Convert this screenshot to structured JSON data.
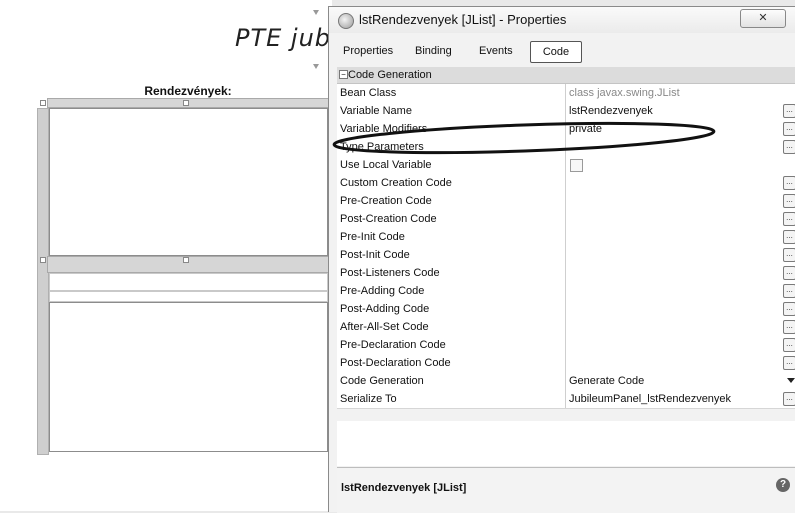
{
  "designer": {
    "title": "PTE jub",
    "panel_header": "Rendezvények:"
  },
  "window": {
    "title": "lstRendezvenyek [JList] - Properties",
    "close_label": "✕"
  },
  "tabs": [
    {
      "label": "Properties",
      "active": false
    },
    {
      "label": "Binding",
      "active": false
    },
    {
      "label": "Events",
      "active": false
    },
    {
      "label": "Code",
      "active": true
    }
  ],
  "category": {
    "label": "Code Generation",
    "expanded_symbol": "−"
  },
  "properties": [
    {
      "name": "Bean Class",
      "value": "class javax.swing.JList",
      "kind": "muted"
    },
    {
      "name": "Variable Name",
      "value": "lstRendezvenyek",
      "kind": "ellipsis"
    },
    {
      "name": "Variable Modifiers",
      "value": "private",
      "kind": "ellipsis"
    },
    {
      "name": "Type Parameters",
      "value": "",
      "kind": "ellipsis"
    },
    {
      "name": "Use Local Variable",
      "value": "",
      "kind": "checkbox"
    },
    {
      "name": "Custom Creation Code",
      "value": "",
      "kind": "ellipsis"
    },
    {
      "name": "Pre-Creation Code",
      "value": "",
      "kind": "ellipsis"
    },
    {
      "name": "Post-Creation Code",
      "value": "",
      "kind": "ellipsis"
    },
    {
      "name": "Pre-Init Code",
      "value": "",
      "kind": "ellipsis"
    },
    {
      "name": "Post-Init Code",
      "value": "",
      "kind": "ellipsis"
    },
    {
      "name": "Post-Listeners Code",
      "value": "",
      "kind": "ellipsis"
    },
    {
      "name": "Pre-Adding Code",
      "value": "",
      "kind": "ellipsis"
    },
    {
      "name": "Post-Adding Code",
      "value": "",
      "kind": "ellipsis"
    },
    {
      "name": "After-All-Set Code",
      "value": "",
      "kind": "ellipsis"
    },
    {
      "name": "Pre-Declaration Code",
      "value": "",
      "kind": "ellipsis"
    },
    {
      "name": "Post-Declaration Code",
      "value": "",
      "kind": "ellipsis"
    },
    {
      "name": "Code Generation",
      "value": "Generate Code",
      "kind": "dropdown"
    },
    {
      "name": "Serialize To",
      "value": "JubileumPanel_lstRendezvenyek",
      "kind": "ellipsis"
    }
  ],
  "ellipsis_label": "...",
  "description": {
    "title": "lstRendezvenyek [JList]",
    "help_label": "?"
  }
}
